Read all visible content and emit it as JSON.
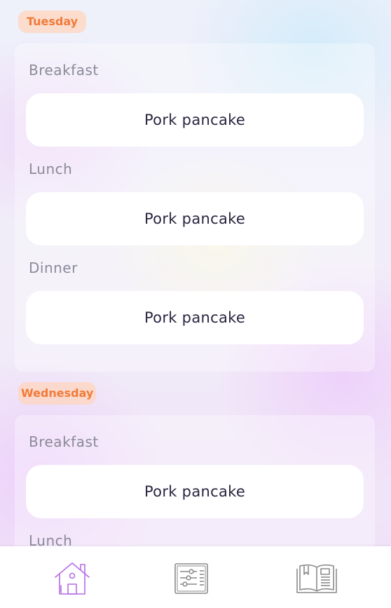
{
  "days": [
    {
      "name": "Tuesday",
      "meals": [
        {
          "label": "Breakfast",
          "dish": "Pork pancake"
        },
        {
          "label": "Lunch",
          "dish": "Pork pancake"
        },
        {
          "label": "Dinner",
          "dish": "Pork pancake"
        }
      ]
    },
    {
      "name": "Wednesday",
      "meals": [
        {
          "label": "Breakfast",
          "dish": "Pork pancake"
        },
        {
          "label": "Lunch",
          "dish": ""
        }
      ]
    }
  ],
  "tabbar": {
    "items": [
      {
        "icon": "home-icon",
        "active": true
      },
      {
        "icon": "sliders-icon",
        "active": false
      },
      {
        "icon": "book-icon",
        "active": false
      }
    ]
  },
  "colors": {
    "badge_text": "#f07b3a",
    "badge_bg": "#ffd6be",
    "active_icon": "#b66ce6",
    "inactive_icon": "#8a8a8a"
  }
}
